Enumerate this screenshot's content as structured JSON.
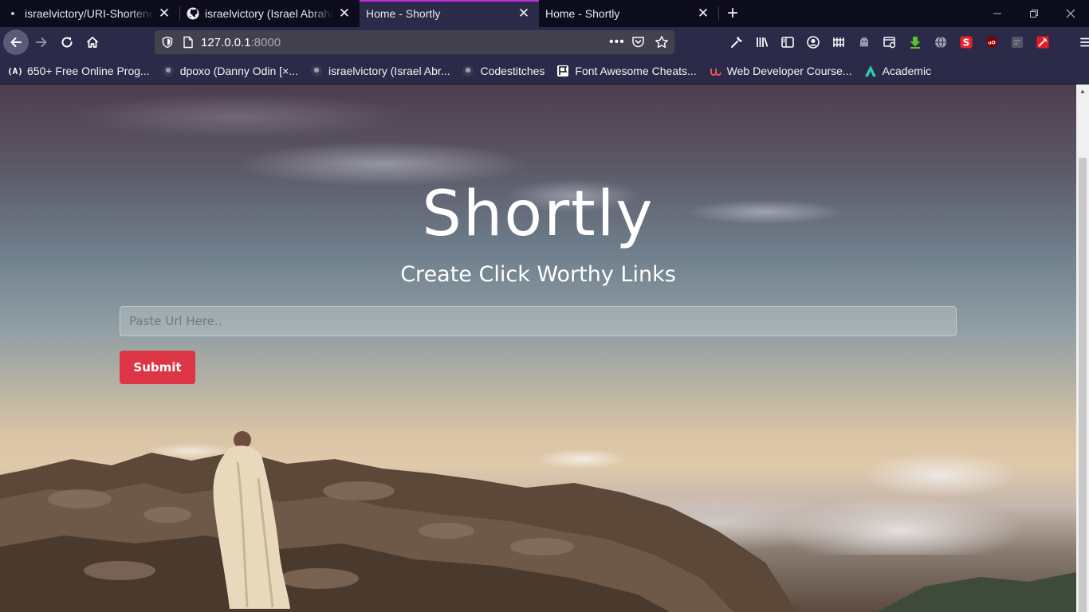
{
  "browser": {
    "tabs": [
      {
        "title": "israelvictory/URI-Shortener",
        "favicon": "dot-icon"
      },
      {
        "title": "israelvictory (Israel Abraham)",
        "favicon": "github-icon"
      },
      {
        "title": "Home - Shortly",
        "favicon": "none",
        "active": true
      },
      {
        "title": "Home - Shortly",
        "favicon": "none"
      }
    ],
    "url": {
      "host": "127.0.0.1",
      "port": ":8000"
    },
    "bookmarks": [
      {
        "label": "650+ Free Online Prog...",
        "icon": "code-icon"
      },
      {
        "label": "dpoxo (Danny Odin [×...",
        "icon": "github-icon"
      },
      {
        "label": "israelvictory (Israel Abr...",
        "icon": "github-icon"
      },
      {
        "label": "Codestitches",
        "icon": "github-icon"
      },
      {
        "label": "Font Awesome Cheats...",
        "icon": "flag-icon"
      },
      {
        "label": "Web Developer Course...",
        "icon": "udemy-icon"
      },
      {
        "label": "Academic",
        "icon": "academic-icon"
      }
    ],
    "colors": {
      "accent": "#c52bdc",
      "toolbar": "#2b2a48",
      "tabstrip": "#0c0c1d"
    }
  },
  "page": {
    "logo": "Shortly",
    "tagline": "Create Click Worthy Links",
    "url_input": {
      "placeholder": "Paste Url Here..",
      "value": ""
    },
    "submit_label": "Submit",
    "colors": {
      "submit": "#dc3545"
    }
  }
}
